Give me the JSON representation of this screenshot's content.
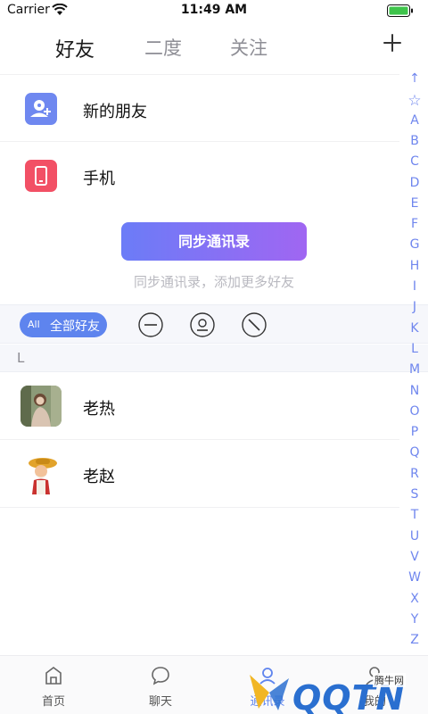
{
  "status": {
    "carrier": "Carrier",
    "time": "11:49 AM"
  },
  "tabs": [
    {
      "label": "好友",
      "active": true
    },
    {
      "label": "二度",
      "active": false
    },
    {
      "label": "关注",
      "active": false
    }
  ],
  "menu": {
    "new_friends": "新的朋友",
    "phone": "手机"
  },
  "sync": {
    "button": "同步通讯录",
    "hint": "同步通讯录，添加更多好友"
  },
  "filter": {
    "tag": "All",
    "label": "全部好友"
  },
  "section_letter": "L",
  "contacts": [
    {
      "name": "老热"
    },
    {
      "name": "老赵"
    }
  ],
  "index": [
    "↑",
    "☆",
    "A",
    "B",
    "C",
    "D",
    "E",
    "F",
    "G",
    "H",
    "I",
    "J",
    "K",
    "L",
    "M",
    "N",
    "O",
    "P",
    "Q",
    "R",
    "S",
    "T",
    "U",
    "V",
    "W",
    "X",
    "Y",
    "Z"
  ],
  "nav": [
    {
      "label": "首页",
      "icon": "home-icon"
    },
    {
      "label": "聊天",
      "icon": "chat-icon"
    },
    {
      "label": "通讯录",
      "icon": "contacts-icon"
    },
    {
      "label": "我的",
      "icon": "profile-icon"
    }
  ],
  "watermark": {
    "text": "QQTN",
    "sub": "腾牛网"
  },
  "colors": {
    "accent": "#5e84ee",
    "gradient_start": "#6b7cf7",
    "gradient_end": "#a066f2",
    "phone_icon": "#f25065"
  }
}
